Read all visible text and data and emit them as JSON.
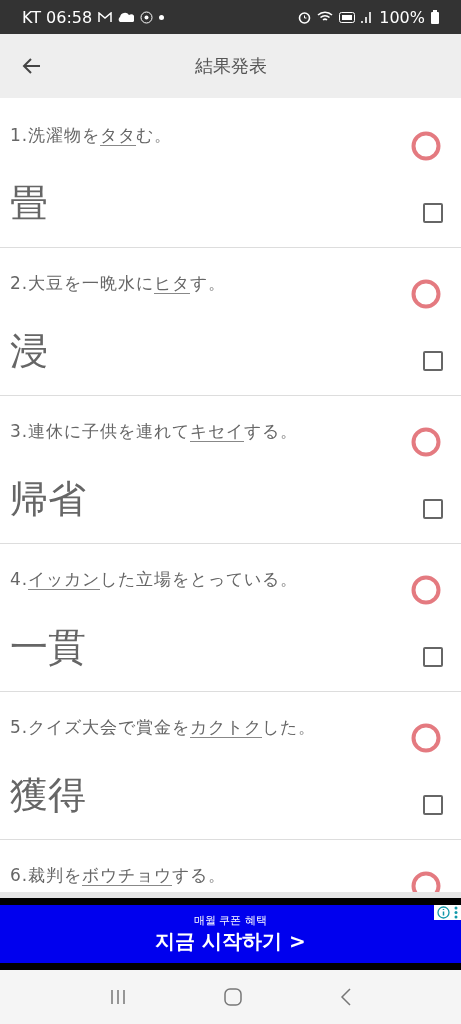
{
  "status_bar": {
    "carrier_time": "KT 06:58",
    "battery": "100%"
  },
  "app_bar": {
    "title": "結果発表"
  },
  "questions": [
    {
      "before": "1.洗濯物を",
      "blank": "タタ",
      "after": "む。",
      "answer": "畳",
      "correct": true,
      "checked": false
    },
    {
      "before": "2.大豆を一晩水に",
      "blank": "ヒタ",
      "after": "す。",
      "answer": "浸",
      "correct": true,
      "checked": false
    },
    {
      "before": "3.連休に子供を連れて",
      "blank": "キセイ",
      "after": "する。",
      "answer": "帰省",
      "correct": true,
      "checked": false
    },
    {
      "before": "4.",
      "blank": "イッカン",
      "after": "した立場をとっている。",
      "answer": "一貫",
      "correct": true,
      "checked": false
    },
    {
      "before": "5.クイズ大会で賞金を",
      "blank": "カクトク",
      "after": "した。",
      "answer": "獲得",
      "correct": true,
      "checked": false
    },
    {
      "before": "6.裁判を",
      "blank": "ボウチョウ",
      "after": "する。",
      "correct": true
    }
  ],
  "ad": {
    "subtitle": "매월 쿠폰 혜택",
    "headline": "지금 시작하기 >"
  }
}
